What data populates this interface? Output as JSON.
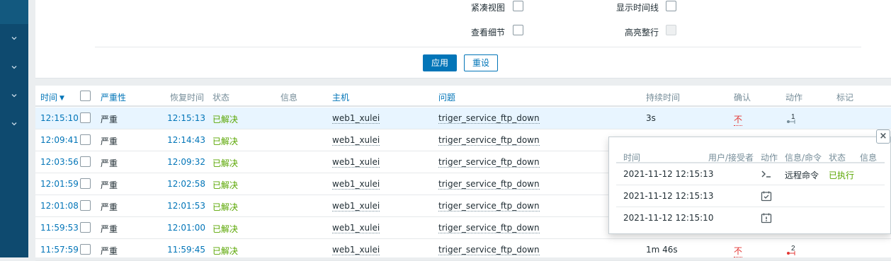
{
  "filter": {
    "compact_view_label": "紧凑视图",
    "show_timeline_label": "显示时间线",
    "show_details_label": "查看细节",
    "highlight_row_label": "高亮整行",
    "apply_label": "应用",
    "reset_label": "重设"
  },
  "table": {
    "headers": {
      "time": "时间",
      "severity": "严重性",
      "recovery_time": "恢复时间",
      "status": "状态",
      "info": "信息",
      "host": "主机",
      "problem": "问题",
      "duration": "持续时间",
      "ack": "确认",
      "actions": "动作",
      "tags": "标记"
    },
    "rows": [
      {
        "time": "12:15:10",
        "severity": "严重",
        "recovery": "12:15:13",
        "status": "已解决",
        "host": "web1_xulei",
        "problem": "triger_service_ftp_down",
        "duration": "3s",
        "ack": "不",
        "actions_count": "1"
      },
      {
        "time": "12:09:41",
        "severity": "严重",
        "recovery": "12:14:43",
        "status": "已解决",
        "host": "web1_xulei",
        "problem": "triger_service_ftp_down",
        "duration": "",
        "ack": "",
        "actions_count": ""
      },
      {
        "time": "12:03:56",
        "severity": "严重",
        "recovery": "12:09:32",
        "status": "已解决",
        "host": "web1_xulei",
        "problem": "triger_service_ftp_down",
        "duration": "",
        "ack": "",
        "actions_count": ""
      },
      {
        "time": "12:01:59",
        "severity": "严重",
        "recovery": "12:02:58",
        "status": "已解决",
        "host": "web1_xulei",
        "problem": "triger_service_ftp_down",
        "duration": "",
        "ack": "",
        "actions_count": ""
      },
      {
        "time": "12:01:08",
        "severity": "严重",
        "recovery": "12:01:53",
        "status": "已解决",
        "host": "web1_xulei",
        "problem": "triger_service_ftp_down",
        "duration": "",
        "ack": "",
        "actions_count": ""
      },
      {
        "time": "11:59:53",
        "severity": "严重",
        "recovery": "12:01:00",
        "status": "已解决",
        "host": "web1_xulei",
        "problem": "triger_service_ftp_down",
        "duration": "",
        "ack": "",
        "actions_count": ""
      },
      {
        "time": "11:57:59",
        "severity": "严重",
        "recovery": "11:59:45",
        "status": "已解决",
        "host": "web1_xulei",
        "problem": "triger_service_ftp_down",
        "duration": "1m 46s",
        "ack": "不",
        "actions_count": "2"
      }
    ]
  },
  "popup": {
    "close_glyph": "×",
    "headers": {
      "time": "时间",
      "user": "用户/接受者",
      "action": "动作",
      "message": "信息/命令",
      "status": "状态",
      "info": "信息"
    },
    "rows": [
      {
        "time": "2021-11-12 12:15:13",
        "icon": "terminal-icon",
        "message": "远程命令",
        "status": "已执行"
      },
      {
        "time": "2021-11-12 12:15:13",
        "icon": "calendar-check-icon",
        "message": "",
        "status": ""
      },
      {
        "time": "2021-11-12 12:15:10",
        "icon": "calendar-alert-icon",
        "message": "",
        "status": ""
      }
    ]
  },
  "colors": {
    "sidebar": "#0e4a6f",
    "accent": "#0275b8",
    "resolved": "#59a600",
    "unack": "#e33734"
  }
}
